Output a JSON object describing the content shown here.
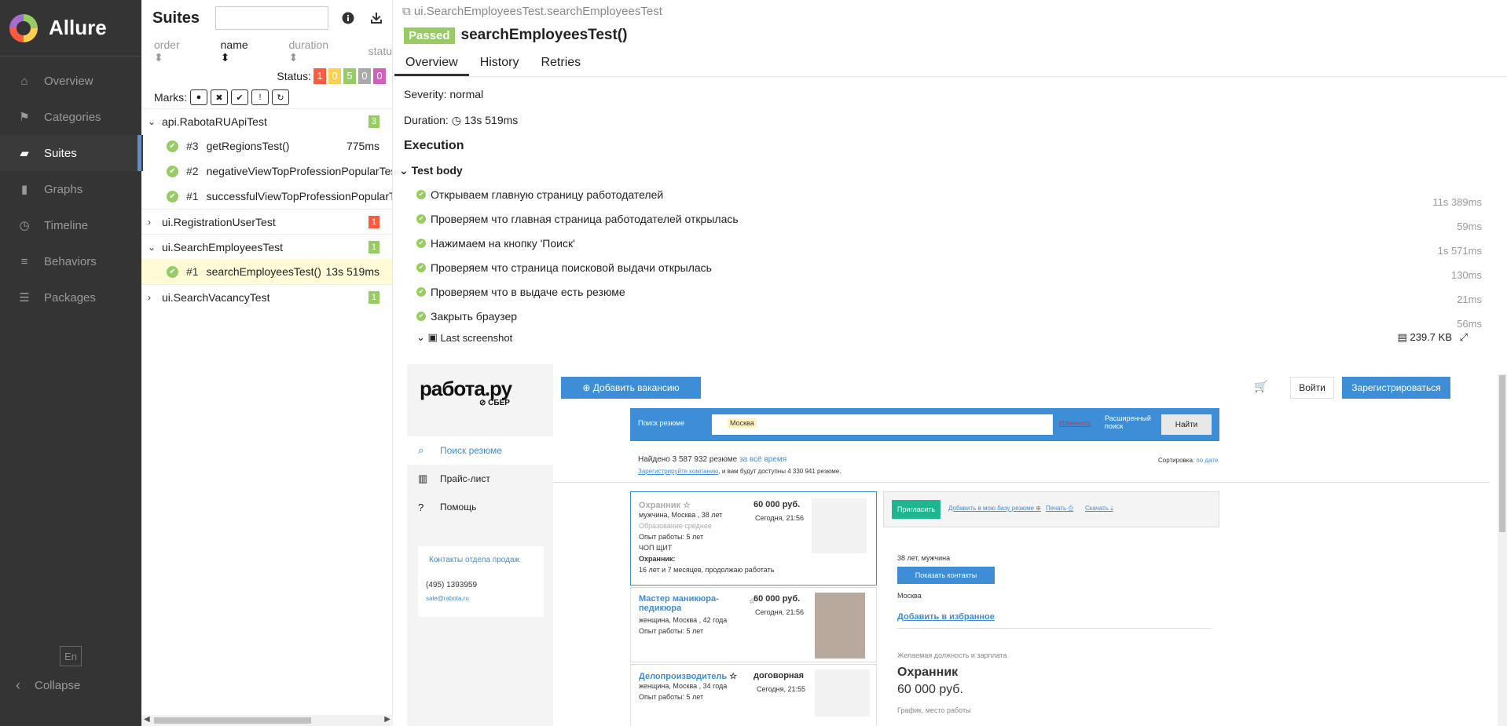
{
  "app": {
    "brand": "Allure",
    "lang": "En",
    "collapse": "Collapse"
  },
  "nav": [
    {
      "label": "Overview",
      "icon": "home-icon"
    },
    {
      "label": "Categories",
      "icon": "flag-icon"
    },
    {
      "label": "Suites",
      "icon": "briefcase-icon",
      "active": true
    },
    {
      "label": "Graphs",
      "icon": "bar-chart-icon"
    },
    {
      "label": "Timeline",
      "icon": "clock-icon"
    },
    {
      "label": "Behaviors",
      "icon": "list-icon"
    },
    {
      "label": "Packages",
      "icon": "align-left-icon"
    }
  ],
  "tree": {
    "title": "Suites",
    "sort": {
      "order": "order",
      "name": "name",
      "duration": "duration",
      "status": "statu"
    },
    "status_label": "Status:",
    "status_counts": [
      {
        "v": "1",
        "color": "#fd5a3e"
      },
      {
        "v": "0",
        "color": "#ffd050"
      },
      {
        "v": "5",
        "color": "#97cc64"
      },
      {
        "v": "0",
        "color": "#aaaaaa"
      },
      {
        "v": "0",
        "color": "#d35ebe"
      }
    ],
    "marks_label": "Marks:",
    "groups": [
      {
        "name": "api.RabotaRUApiTest",
        "count": "3",
        "count_color": "#97cc64",
        "expanded": true,
        "items": [
          {
            "num": "#3",
            "name": "getRegionsTest()",
            "dur": "775ms"
          },
          {
            "num": "#2",
            "name": "negativeViewTopProfessionPopularTest()",
            "dur": ""
          },
          {
            "num": "#1",
            "name": "successfulViewTopProfessionPopularTest()",
            "dur": ""
          }
        ]
      },
      {
        "name": "ui.RegistrationUserTest",
        "count": "1",
        "count_color": "#fd5a3e",
        "expanded": false,
        "items": []
      },
      {
        "name": "ui.SearchEmployeesTest",
        "count": "1",
        "count_color": "#97cc64",
        "expanded": true,
        "items": [
          {
            "num": "#1",
            "name": "searchEmployeesTest()",
            "dur": "13s 519ms",
            "selected": true
          }
        ]
      },
      {
        "name": "ui.SearchVacancyTest",
        "count": "1",
        "count_color": "#97cc64",
        "expanded": false,
        "items": []
      }
    ]
  },
  "detail": {
    "crumb": "ui.SearchEmployeesTest.searchEmployeesTest",
    "status": "Passed",
    "title": "searchEmployeesTest()",
    "tabs": [
      "Overview",
      "History",
      "Retries"
    ],
    "severity_label": "Severity:",
    "severity": "normal",
    "duration_label": "Duration:",
    "duration": "13s 519ms",
    "execution": "Execution",
    "test_body": "Test body",
    "steps": [
      {
        "name": "Открываем главную страницу работодателей",
        "dur": "11s 389ms"
      },
      {
        "name": "Проверяем что главная страница работодателей открылась",
        "dur": "59ms"
      },
      {
        "name": "Нажимаем на кнопку 'Поиск'",
        "dur": "1s 571ms"
      },
      {
        "name": "Проверяем что страница поисковой выдачи открылась",
        "dur": "130ms"
      },
      {
        "name": "Проверяем что в выдаче есть резюме",
        "dur": "21ms"
      },
      {
        "name": "Закрыть браузер",
        "dur": "56ms"
      }
    ],
    "attachment": {
      "name": "Last screenshot",
      "size": "239.7 KB"
    }
  },
  "shot": {
    "logo": "работа.ру",
    "sber": "СБЕР",
    "add_vacancy": "Добавить вакансию",
    "login": "Войти",
    "register": "Зарегистрироваться",
    "side": [
      "Поиск резюме",
      "Прайс-лист",
      "Помощь"
    ],
    "contacts_title": "Контакты отдела продаж",
    "phone": "(495) 1393959",
    "email": "sale@rabota.ru",
    "search_mode": "Поиск резюме",
    "city": "Москва",
    "change": "Изменить",
    "advanced": "Расширенный поиск",
    "find": "Найти",
    "found": "Найдено 3 587 932 резюме",
    "all_time": "за всё время",
    "register_company": "Зарегистрируйте компанию",
    "reg_note": ", и вам будут доступны 4 330 941 резюме.",
    "sort_label": "Сортировка:",
    "sort_val": "по дате",
    "cards": [
      {
        "title": "Охранник",
        "meta": "мужчина, Москва , 38 лет",
        "edu": "Образование среднее",
        "exp": "Опыт работы: 5 лет",
        "org": "ЧОП ЩИТ",
        "pos": "Охранник:",
        "period": "16 лет и 7 месяцев, продолжаю работать",
        "salary": "60 000 руб.",
        "date": "Сегодня, 21:56"
      },
      {
        "title": "Мастер маникюра-педикюра",
        "meta": "женщина, Москва , 42 года",
        "exp": "Опыт работы: 5 лет",
        "salary": "60 000 руб.",
        "date": "Сегодня, 21:56"
      },
      {
        "title": "Делопроизводитель",
        "meta": "женщина, Москва , 34 года",
        "exp": "Опыт работы: 5 лет",
        "salary": "договорная",
        "date": "Сегодня, 21:55"
      }
    ],
    "invite": "Пригласить",
    "add_base": "Добавить в мою базу резюме",
    "print": "Печать",
    "download": "Скачать",
    "person": "38 лет, мужчина",
    "show_contacts": "Показать контакты",
    "person_city": "Москва",
    "add_fav": "Добавить в избранное",
    "desired": "Желаемая должность и зарплата",
    "desired_title": "Охранник",
    "desired_salary": "60 000 руб.",
    "schedule": "График, место работы"
  }
}
